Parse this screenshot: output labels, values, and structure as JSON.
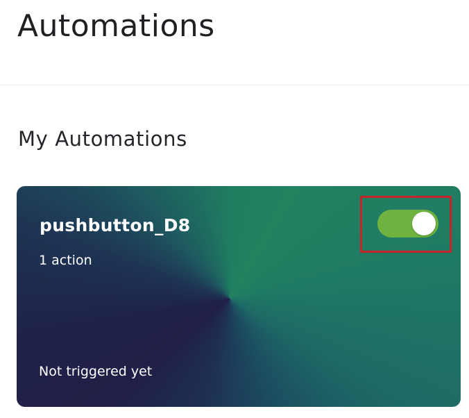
{
  "page": {
    "title": "Automations"
  },
  "section": {
    "title": "My Automations"
  },
  "automations": [
    {
      "name": "pushbutton_D8",
      "actions_label": "1 action",
      "status": "Not triggered yet",
      "enabled": true
    }
  ],
  "colors": {
    "toggle_on": "#6fb240",
    "highlight_box": "#c4242a",
    "card_dark": "#201f47",
    "card_green": "#22835f"
  }
}
